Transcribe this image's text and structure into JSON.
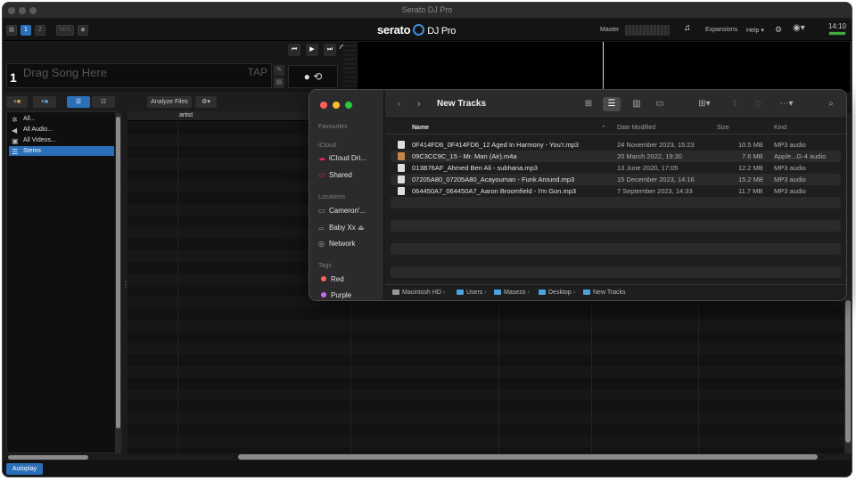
{
  "window": {
    "title": "Serato DJ Pro"
  },
  "topbar": {
    "deck_buttons": [
      "1",
      "2"
    ],
    "mix_label": "MIX",
    "logo": "serato",
    "logo_product": "DJ Pro",
    "master_label": "Master",
    "expansions_label": "Expansions",
    "help_label": "Help",
    "clock": "14:10"
  },
  "deck": {
    "number": "1",
    "placeholder": "Drag Song Here",
    "tap_label": "TAP"
  },
  "library_toolbar": {
    "analyze_label": "Analyze Files"
  },
  "sidebar": {
    "items": [
      {
        "label": "All...",
        "icon": "crate-icon"
      },
      {
        "label": "All Audio...",
        "icon": "speaker-icon"
      },
      {
        "label": "All Videos...",
        "icon": "video-icon"
      },
      {
        "label": "Stems",
        "icon": "stems-icon",
        "selected": true
      }
    ]
  },
  "tracklist": {
    "column_artist": "artist"
  },
  "bottom": {
    "autoplay_label": "Autoplay"
  },
  "finder": {
    "title": "New Tracks",
    "sidebar": {
      "favourites_label": "Favourites",
      "icloud_label": "iCloud",
      "icloud_items": [
        "iCloud Dri...",
        "Shared"
      ],
      "locations_label": "Locations",
      "location_items": [
        "Cameron'...",
        "Baby Xx",
        "Network"
      ],
      "tags_label": "Tags",
      "tags": [
        {
          "label": "Red",
          "color": "#ff5f57"
        },
        {
          "label": "Purple",
          "color": "#c36df0"
        }
      ]
    },
    "columns": {
      "name": "Name",
      "date": "Date Modified",
      "size": "Size",
      "kind": "Kind"
    },
    "files": [
      {
        "name": "0F414FD6_0F414FD6_12 Aged In Harmony - You'r.mp3",
        "date": "24 November 2023, 15:23",
        "size": "10.5 MB",
        "kind": "MP3 audio",
        "icon": "file-icon"
      },
      {
        "name": "09C3CC9C_15 - Mr. Man (Air).m4a",
        "date": "20 March 2022, 19:30",
        "size": "7.6 MB",
        "kind": "Apple...G-4 audio",
        "icon": "artwork-icon"
      },
      {
        "name": "013B76AF_Ahmed Ben Ali - subhana.mp3",
        "date": "13 June 2020, 17:05",
        "size": "12.2 MB",
        "kind": "MP3 audio",
        "icon": "file-icon"
      },
      {
        "name": "07205A80_07205A80_Acayouman - Funk Around.mp3",
        "date": "15 December 2023, 14:16",
        "size": "15.2 MB",
        "kind": "MP3 audio",
        "icon": "file-icon"
      },
      {
        "name": "064450A7_064450A7_Aaron Broomfield - I'm Gon.mp3",
        "date": "7 September 2023, 14:33",
        "size": "11.7 MB",
        "kind": "MP3 audio",
        "icon": "file-icon"
      }
    ],
    "path": [
      "Macintosh HD",
      "Users",
      "Masezo",
      "Desktop",
      "New Tracks"
    ]
  },
  "colors": {
    "accent": "#2a6fb8",
    "finder_close": "#ff5f57",
    "finder_minimize": "#febc2e",
    "finder_zoom": "#28c840"
  }
}
